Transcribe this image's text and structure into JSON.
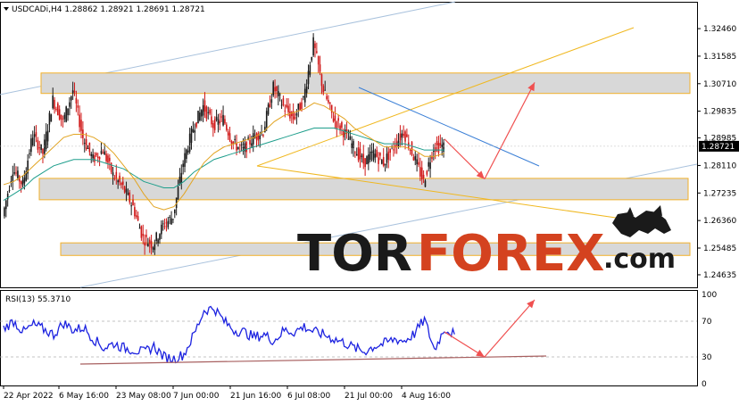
{
  "header": {
    "title": "USDCADi,H4  1.28862 1.28921 1.28691 1.28721",
    "collapse_icon": "triangle-down-icon"
  },
  "watermark": {
    "part1": "TOR",
    "part2": "FOREX",
    "part3": ".com",
    "logo_icon": "bull-bear-icon",
    "colors": {
      "part1": "#1a1a1a",
      "part2": "#d4421f",
      "part3": "#1a1a1a"
    }
  },
  "chart_data": [
    {
      "type": "line",
      "title": "USDCADi,H4",
      "symbol": "USDCADi",
      "timeframe": "H4",
      "ohlc_last": {
        "open": 1.28862,
        "high": 1.28921,
        "low": 1.28691,
        "close": 1.28721
      },
      "current_price_label": "1.28721",
      "ylim": [
        1.2435,
        1.332
      ],
      "y_ticks": [
        "1.32460",
        "1.31585",
        "1.30710",
        "1.29835",
        "1.28985",
        "1.28110",
        "1.27235",
        "1.26360",
        "1.25485",
        "1.24635"
      ],
      "x_ticks": [
        "22 Apr 2022",
        "6 May 16:00",
        "23 May 08:00",
        "7 Jun 00:00",
        "21 Jun 16:00",
        "6 Jul 08:00",
        "21 Jul 00:00",
        "4 Aug 16:00"
      ],
      "colors": {
        "bull": "#1a1a1a",
        "bear": "#d01818",
        "ma_fast": "#e2a422",
        "ma_slow": "#1e9e8c",
        "zone": "#d8d8d8",
        "zone_border": "#f2b02a",
        "channel": "#a9c2dd",
        "trend_up": "#f0b820",
        "resistance": "#3a7fd6",
        "arrow": "#f05050"
      },
      "zones": [
        {
          "low": 1.304,
          "high": 1.3105
        },
        {
          "low": 1.2702,
          "high": 1.277
        },
        {
          "low": 1.2525,
          "high": 1.2565
        }
      ],
      "price": [
        1.265,
        1.28,
        1.275,
        1.291,
        1.285,
        1.302,
        1.295,
        1.305,
        1.29,
        1.283,
        1.286,
        1.278,
        1.274,
        1.268,
        1.258,
        1.256,
        1.262,
        1.265,
        1.282,
        1.293,
        1.3,
        1.294,
        1.296,
        1.288,
        1.286,
        1.29,
        1.292,
        1.306,
        1.3,
        1.296,
        1.302,
        1.32,
        1.305,
        1.296,
        1.292,
        1.287,
        1.282,
        1.285,
        1.282,
        1.287,
        1.292,
        1.284,
        1.276,
        1.287,
        1.2872
      ],
      "ma_fast": [
        1.275,
        1.276,
        1.278,
        1.281,
        1.284,
        1.287,
        1.29,
        1.291,
        1.291,
        1.29,
        1.288,
        1.285,
        1.281,
        1.277,
        1.272,
        1.268,
        1.267,
        1.268,
        1.272,
        1.277,
        1.282,
        1.285,
        1.287,
        1.288,
        1.289,
        1.29,
        1.292,
        1.295,
        1.297,
        1.298,
        1.299,
        1.301,
        1.3,
        1.298,
        1.296,
        1.293,
        1.291,
        1.289,
        1.287,
        1.287,
        1.287,
        1.286,
        1.284,
        1.284,
        1.285
      ],
      "ma_slow": [
        1.27,
        1.272,
        1.274,
        1.277,
        1.279,
        1.281,
        1.282,
        1.283,
        1.283,
        1.283,
        1.282,
        1.281,
        1.28,
        1.278,
        1.276,
        1.275,
        1.274,
        1.274,
        1.276,
        1.279,
        1.281,
        1.283,
        1.284,
        1.285,
        1.286,
        1.287,
        1.288,
        1.289,
        1.29,
        1.291,
        1.292,
        1.293,
        1.293,
        1.293,
        1.292,
        1.291,
        1.29,
        1.289,
        1.288,
        1.288,
        1.288,
        1.287,
        1.286,
        1.286,
        1.286
      ],
      "forecast_arrows": [
        {
          "from": [
            44,
            1.2895
          ],
          "to": [
            48,
            1.2768
          ]
        },
        {
          "from": [
            48,
            1.2768
          ],
          "to": [
            53,
            1.3075
          ]
        }
      ]
    },
    {
      "type": "line",
      "title": "RSI(13) 55.3710",
      "ylim": [
        0,
        100
      ],
      "y_ticks": [
        "100",
        "70",
        "30",
        "0"
      ],
      "levels": [
        70,
        30
      ],
      "values": [
        62,
        70,
        58,
        66,
        61,
        55,
        68,
        60,
        63,
        50,
        40,
        45,
        40,
        38,
        35,
        42,
        30,
        28,
        33,
        55,
        82,
        85,
        70,
        60,
        58,
        52,
        55,
        48,
        60,
        58,
        64,
        58,
        55,
        50,
        46,
        40,
        36,
        42,
        45,
        50,
        48,
        56,
        72,
        38,
        62,
        55.3
      ],
      "forecast_arrows": [
        {
          "from": [
            44,
            58
          ],
          "to": [
            48,
            30
          ]
        },
        {
          "from": [
            48,
            30
          ],
          "to": [
            53,
            94
          ]
        }
      ],
      "colors": {
        "line": "#1c22e0",
        "trend": "#a86060",
        "arrow": "#f05050"
      }
    }
  ]
}
